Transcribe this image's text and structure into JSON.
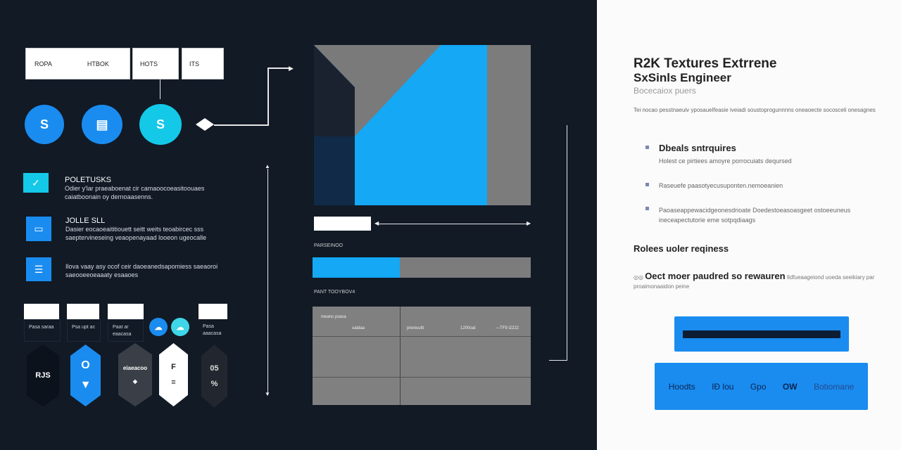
{
  "top_tabs": [
    "ROPA",
    "HTBOK",
    "HOTS",
    "ITS"
  ],
  "circles": [
    {
      "icon": "s-logo-icon",
      "glyph": "S",
      "color": "#1a8cf0"
    },
    {
      "icon": "card-icon",
      "glyph": "▤",
      "color": "#1a8cf0"
    },
    {
      "icon": "s-logo-icon",
      "glyph": "S",
      "color": "#14c8e8"
    }
  ],
  "features": [
    {
      "title": "POLETUSKS",
      "text": "Odier y'lar praeaboenat cir camaoocoeasitoouaes caiatboonain oy dernoaasenns.",
      "icon": "check-icon",
      "color": "#14c8e8"
    },
    {
      "title": "JOLLE SLL",
      "text": "Dasier eocaoeaititiouett seitt weits teoabircec sss saeptervineseing veaopenayaad looeon ugeocalle",
      "icon": "card-icon",
      "color": "#1a8cf0"
    },
    {
      "title": "",
      "text": "Ilova vaay asy ocof ceir daoeanedsapomiess saeaoroi saeooeeoeaaaty esaaoes",
      "icon": "list-icon",
      "color": "#1a8cf0"
    }
  ],
  "cards": [
    {
      "text": "Pasa saraa"
    },
    {
      "text": "Psa upt ac"
    },
    {
      "text": "Paat ar eaacasa"
    },
    {
      "text": "Pasa aaacasa"
    }
  ],
  "hexes": [
    {
      "label": "RJS"
    },
    {
      "label": "O"
    },
    {
      "label": "eiaeacoo"
    },
    {
      "label": "F"
    },
    {
      "label": "05"
    }
  ],
  "center": {
    "label1": "PARSEINOO",
    "progress": 0.4,
    "label2": "PANT TOOYBOV4",
    "table": {
      "header_left": [
        "means yoasa",
        "uaidaa"
      ],
      "header_right": [
        "prexiuuitt",
        "1200oat",
        "—TF9 i2222"
      ]
    }
  },
  "right": {
    "title": "R2K Textures Extrrene",
    "subtitle": "SxSinls Engineer",
    "tagline": "Bocecaiox puers",
    "intro": "Tei nocao pesstnaeuiv yposauelfeasie iveiadi soustoprogunnnns oneaoecte socosceli onesagnes",
    "reqs": [
      {
        "title": "Dbeals sntrquires",
        "text": "Holest ce pirtiees amoyre porrocuiats deqursed"
      },
      {
        "title": "",
        "text": "Raseuefe paasotyecusuponten.nemoeanien"
      },
      {
        "title": "",
        "text": "Paoaseappewacidgeonesdrioate Doedestoeasoasgeet ostoeeuneus ineceapectutorie eme sotpqdiaags"
      }
    ],
    "section": "Rolees uoler reqiness",
    "highlight_bold": "Oect moer paudred so rewauren",
    "highlight_rest": "Ildfueaageiond uoeda seeikiary par proaimonaaidon peine",
    "nav": [
      "Hoodts",
      "IÐ lou",
      "Gpo",
      "OW",
      "Botiomane"
    ],
    "accent": "#1a8cf0"
  }
}
